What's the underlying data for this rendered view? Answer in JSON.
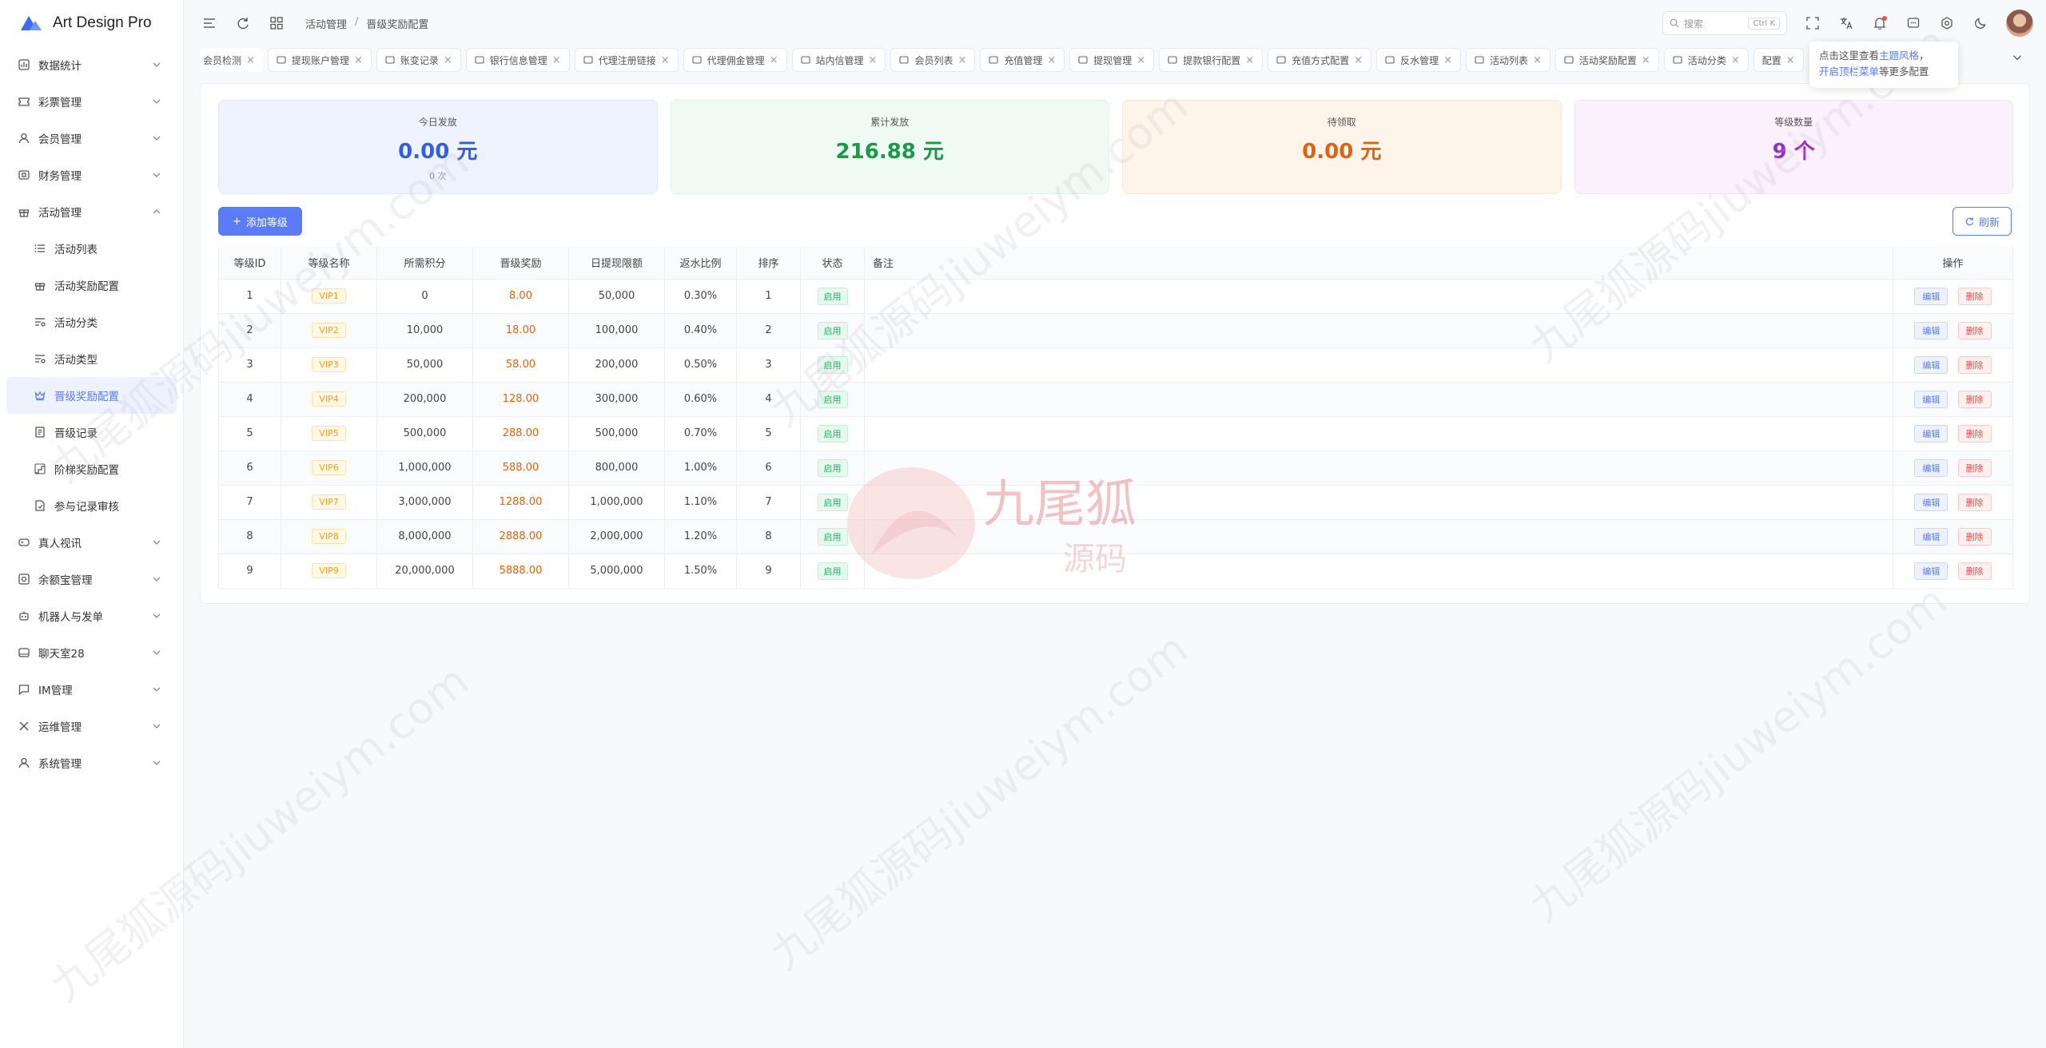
{
  "app": {
    "title": "Art Design Pro"
  },
  "sidebar": {
    "items": [
      {
        "label": "数据统计",
        "icon": "chart-icon"
      },
      {
        "label": "彩票管理",
        "icon": "ticket-icon"
      },
      {
        "label": "会员管理",
        "icon": "user-icon"
      },
      {
        "label": "财务管理",
        "icon": "wallet-icon"
      },
      {
        "label": "活动管理",
        "icon": "gift-icon"
      }
    ],
    "sub_items": [
      {
        "label": "活动列表",
        "icon": "list-icon"
      },
      {
        "label": "活动奖励配置",
        "icon": "gift-icon"
      },
      {
        "label": "活动分类",
        "icon": "filter-list-icon"
      },
      {
        "label": "活动类型",
        "icon": "filter-list-icon"
      },
      {
        "label": "晋级奖励配置",
        "icon": "crown-icon"
      },
      {
        "label": "晋级记录",
        "icon": "document-icon"
      },
      {
        "label": "阶梯奖励配置",
        "icon": "ladder-icon"
      },
      {
        "label": "参与记录审核",
        "icon": "file-check-icon"
      }
    ],
    "items_after": [
      {
        "label": "真人视讯",
        "icon": "gamepad-icon"
      },
      {
        "label": "余额宝管理",
        "icon": "safe-icon"
      },
      {
        "label": "机器人与发单",
        "icon": "robot-icon"
      },
      {
        "label": "聊天室28",
        "icon": "chat-box-icon"
      },
      {
        "label": "IM管理",
        "icon": "message-icon"
      },
      {
        "label": "运维管理",
        "icon": "tools-icon"
      },
      {
        "label": "系统管理",
        "icon": "user-gear-icon"
      }
    ]
  },
  "header": {
    "breadcrumb": [
      "活动管理",
      "晋级奖励配置"
    ],
    "search_placeholder": "搜索",
    "search_shortcut": "Ctrl K"
  },
  "tabs": [
    {
      "label": "会员检测",
      "icon": ""
    },
    {
      "label": "提现账户管理",
      "icon": "card-icon"
    },
    {
      "label": "账变记录",
      "icon": "document-icon"
    },
    {
      "label": "银行信息管理",
      "icon": "bank-icon"
    },
    {
      "label": "代理注册链接",
      "icon": "share-icon"
    },
    {
      "label": "代理佣金管理",
      "icon": "coin-icon"
    },
    {
      "label": "站内信管理",
      "icon": "mail-icon"
    },
    {
      "label": "会员列表",
      "icon": "user-icon"
    },
    {
      "label": "充值管理",
      "icon": "recharge-icon"
    },
    {
      "label": "提现管理",
      "icon": "card-icon"
    },
    {
      "label": "提款银行配置",
      "icon": "bank-icon"
    },
    {
      "label": "充值方式配置",
      "icon": "settings-icon"
    },
    {
      "label": "反水管理",
      "icon": "refresh-icon"
    },
    {
      "label": "活动列表",
      "icon": "list-icon"
    },
    {
      "label": "活动奖励配置",
      "icon": "gift-icon"
    },
    {
      "label": "活动分类",
      "icon": "filter-list-icon"
    }
  ],
  "tab_hidden_partial": "配置",
  "tooltip": {
    "prefix": "点击这里查看",
    "link1": "主题风格",
    "comma": "，",
    "link2": "开启顶栏菜单",
    "suffix": "等更多配置"
  },
  "stats": [
    {
      "title": "今日发放",
      "value": "0.00 元",
      "sub": "0 次"
    },
    {
      "title": "累计发放",
      "value": "216.88 元",
      "sub": ""
    },
    {
      "title": "待领取",
      "value": "0.00 元",
      "sub": ""
    },
    {
      "title": "等级数量",
      "value": "9 个",
      "sub": ""
    }
  ],
  "actions": {
    "add": "添加等级",
    "refresh": "刷新"
  },
  "table": {
    "columns": [
      "等级ID",
      "等级名称",
      "所需积分",
      "晋级奖励",
      "日提现限额",
      "返水比例",
      "排序",
      "状态",
      "备注",
      "操作"
    ],
    "rows": [
      {
        "id": "1",
        "name": "VIP1",
        "points": "0",
        "reward": "8.00",
        "limit": "50,000",
        "rebate": "0.30%",
        "sort": "1",
        "status": "启用",
        "note": ""
      },
      {
        "id": "2",
        "name": "VIP2",
        "points": "10,000",
        "reward": "18.00",
        "limit": "100,000",
        "rebate": "0.40%",
        "sort": "2",
        "status": "启用",
        "note": ""
      },
      {
        "id": "3",
        "name": "VIP3",
        "points": "50,000",
        "reward": "58.00",
        "limit": "200,000",
        "rebate": "0.50%",
        "sort": "3",
        "status": "启用",
        "note": ""
      },
      {
        "id": "4",
        "name": "VIP4",
        "points": "200,000",
        "reward": "128.00",
        "limit": "300,000",
        "rebate": "0.60%",
        "sort": "4",
        "status": "启用",
        "note": ""
      },
      {
        "id": "5",
        "name": "VIP5",
        "points": "500,000",
        "reward": "288.00",
        "limit": "500,000",
        "rebate": "0.70%",
        "sort": "5",
        "status": "启用",
        "note": ""
      },
      {
        "id": "6",
        "name": "VIP6",
        "points": "1,000,000",
        "reward": "588.00",
        "limit": "800,000",
        "rebate": "1.00%",
        "sort": "6",
        "status": "启用",
        "note": ""
      },
      {
        "id": "7",
        "name": "VIP7",
        "points": "3,000,000",
        "reward": "1288.00",
        "limit": "1,000,000",
        "rebate": "1.10%",
        "sort": "7",
        "status": "启用",
        "note": ""
      },
      {
        "id": "8",
        "name": "VIP8",
        "points": "8,000,000",
        "reward": "2888.00",
        "limit": "2,000,000",
        "rebate": "1.20%",
        "sort": "8",
        "status": "启用",
        "note": ""
      },
      {
        "id": "9",
        "name": "VIP9",
        "points": "20,000,000",
        "reward": "5888.00",
        "limit": "5,000,000",
        "rebate": "1.50%",
        "sort": "9",
        "status": "启用",
        "note": ""
      }
    ],
    "edit_label": "编辑",
    "delete_label": "删除"
  },
  "watermark": {
    "text": "九尾狐源码jiuweiym.com",
    "logo_main": "九尾狐",
    "logo_sub": "源码"
  },
  "colors": {
    "accent": "#5b7cf6",
    "success": "#19b26b",
    "danger": "#f04848",
    "warning": "#f0a020"
  }
}
